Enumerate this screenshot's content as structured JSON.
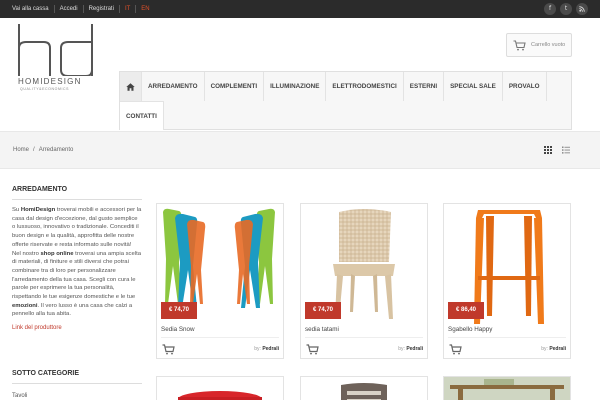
{
  "topbar": {
    "links": [
      "Vai alla cassa",
      "Accedi",
      "Registrati"
    ],
    "lang_it": "IT",
    "lang_en": "EN",
    "social": [
      "f",
      "t",
      "rss"
    ]
  },
  "logo": {
    "mark": "hd",
    "name": "HOMIDESIGN",
    "tagline": "QUALITY&ECONOMICS"
  },
  "cart": {
    "label": "Carrello vuoto"
  },
  "nav": {
    "items": [
      "ARREDAMENTO",
      "COMPLEMENTI",
      "ILLUMINAZIONE",
      "ELETTRODOMESTICI",
      "ESTERNI",
      "SPECIAL SALE",
      "PROVALO"
    ],
    "items_row2": [
      "CONTATTI"
    ]
  },
  "breadcrumb": {
    "home": "Home",
    "sep": "/",
    "current": "Arredamento"
  },
  "sidebar": {
    "title": "ARREDAMENTO",
    "p1_pre": "Su ",
    "p1_brand": "HomiDesign",
    "p1_post": " troverai mobili e accessori per la casa dal design d'eccezione, dal gusto semplice o lussuoso, innovativo o tradizionale. Concediti il buon design e la qualità, approfitta delle nostre offerte riservate e resta informato sulle novità!",
    "p2_pre": "Nel nostro ",
    "p2_shop": "shop online",
    "p2_mid": " troverai una ampia scelta di materiali, di finiture e stili diversi che potrai combinare tra di loro per personalizzare l'arredamento della tua casa. Scegli con cura le parole per esprimere la tua personalità, rispettando le tue esigenze domestiche e le tue ",
    "p2_emo": "emozioni",
    "p2_post": ". Il vero lusso è una casa che calzi a pennello alla tua abita.",
    "link": "Link del produttore",
    "title2": "SOTTO CATEGORIE",
    "sub": "Tavoli"
  },
  "products": [
    {
      "name": "Sedia Snow",
      "price": "€ 74,70",
      "by_label": "by:",
      "brand": "Pedrali"
    },
    {
      "name": "sedia tatami",
      "price": "€ 74,70",
      "by_label": "by:",
      "brand": "Pedrali"
    },
    {
      "name": "Sgabello Happy",
      "price": "€ 86,40",
      "by_label": "by:",
      "brand": "Pedrali"
    }
  ],
  "colors": {
    "topbar": "#2b2b2b",
    "accent": "#c0392b",
    "lang": "#e0502a"
  }
}
